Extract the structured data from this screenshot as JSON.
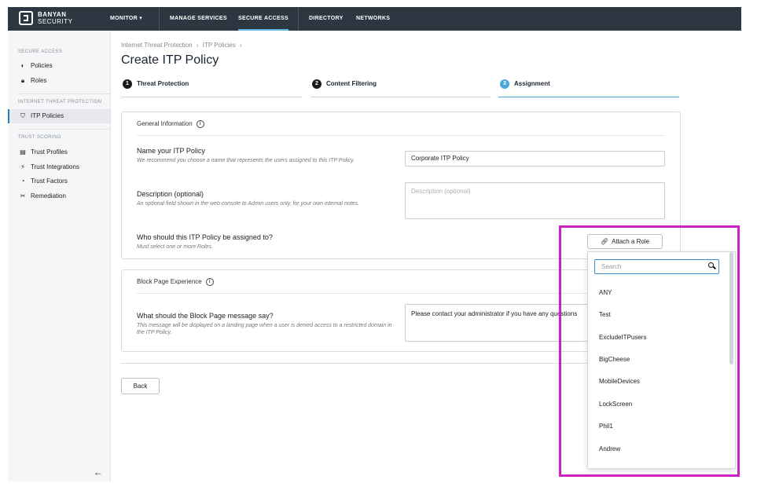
{
  "brand": {
    "name": "BANYAN",
    "subtitle": "SECURITY"
  },
  "topnav": [
    {
      "label": "MONITOR ▾",
      "active": false
    },
    {
      "label": "MANAGE SERVICES",
      "active": false
    },
    {
      "label": "SECURE ACCESS",
      "active": true
    },
    {
      "label": "DIRECTORY",
      "active": false
    },
    {
      "label": "NETWORKS",
      "active": false
    }
  ],
  "sidebar": {
    "sections": [
      {
        "heading": "SECURE ACCESS",
        "items": [
          {
            "label": "Policies",
            "icon": "shield-icon"
          },
          {
            "label": "Roles",
            "icon": "lock-icon"
          }
        ]
      },
      {
        "heading": "INTERNET THREAT PROTECTION",
        "items": [
          {
            "label": "ITP Policies",
            "icon": "shield-outline-icon",
            "active": true
          }
        ]
      },
      {
        "heading": "TRUST SCORING",
        "items": [
          {
            "label": "Trust Profiles",
            "icon": "id-card-icon"
          },
          {
            "label": "Trust Integrations",
            "icon": "plug-icon"
          },
          {
            "label": "Trust Factors",
            "icon": "gauge-icon"
          },
          {
            "label": "Remediation",
            "icon": "tools-icon"
          }
        ]
      }
    ],
    "collapse_icon": "←"
  },
  "breadcrumb": {
    "parts": [
      "Internet Threat Protection",
      "›",
      "ITP Policies",
      "›"
    ]
  },
  "page_title": "Create ITP Policy",
  "steps": [
    {
      "num": "1",
      "label": "Threat Protection",
      "active": false
    },
    {
      "num": "2",
      "label": "Content Filtering",
      "active": false
    },
    {
      "num": "3",
      "label": "Assignment",
      "active": true
    }
  ],
  "general": {
    "title": "General Information",
    "info_glyph": "i",
    "name_label": "Name your ITP Policy",
    "name_help": "We recommend you choose a name that represents the users assigned to this ITP Policy.",
    "name_value": "Corporate ITP Policy",
    "desc_label": "Description (optional)",
    "desc_help": "An optional field shown in the web console to Admin users only, for your own internal notes.",
    "desc_placeholder": "Description (optional)",
    "assign_label": "Who should this ITP Policy be assigned to?",
    "assign_help": "Must select one or more Roles.",
    "attach_button": "Attach a Role"
  },
  "block": {
    "title": "Block Page Experience",
    "info_glyph": "i",
    "msg_label": "What should the Block Page message say?",
    "msg_help": "This message will be displayed on a landing page when a user is denied access to a restricted domain in the ITP Policy.",
    "msg_value": "Please contact your administrator if you have any questions"
  },
  "back_button": "Back",
  "dropdown": {
    "search_placeholder": "Search",
    "options": [
      "ANY",
      "Test",
      "ExcludeITPusers",
      "BigCheese",
      "MobileDevices",
      "LockScreen",
      "Phil1",
      "Andrew"
    ]
  },
  "colors": {
    "topbar": "#2c3742",
    "accent": "#4aa7d6",
    "highlight": "#d020c8"
  }
}
